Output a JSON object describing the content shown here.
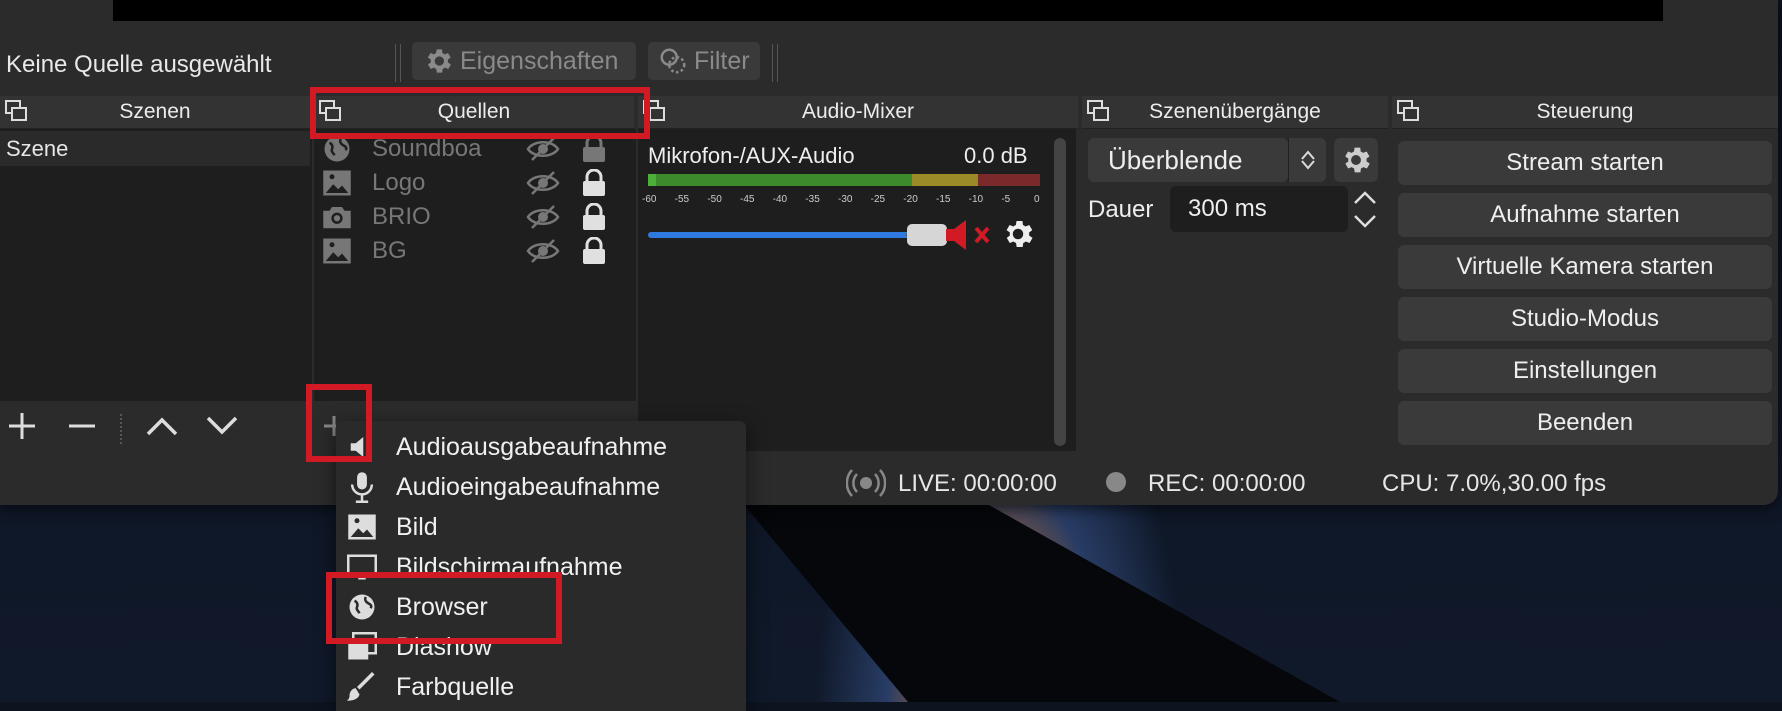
{
  "context_bar": {
    "no_source": "Keine Quelle ausgewählt",
    "properties": "Eigenschaften",
    "filter": "Filter"
  },
  "docks": {
    "scenes": {
      "title": "Szenen",
      "items": [
        "Szene"
      ]
    },
    "sources": {
      "title": "Quellen",
      "items": [
        {
          "name": "Soundboa",
          "icon": "globe-icon"
        },
        {
          "name": "Logo",
          "icon": "image-icon"
        },
        {
          "name": "BRIO",
          "icon": "camera-icon"
        },
        {
          "name": "BG",
          "icon": "image-icon"
        }
      ]
    },
    "mixer": {
      "title": "Audio-Mixer",
      "channel": "Mikrofon-/AUX-Audio",
      "level": "0.0 dB",
      "ticks": [
        "-60",
        "-55",
        "-50",
        "-45",
        "-40",
        "-35",
        "-30",
        "-25",
        "-20",
        "-15",
        "-10",
        "-5",
        "0"
      ],
      "volume_fraction": 0.96
    },
    "transitions": {
      "title": "Szenenübergänge",
      "selected": "Überblende",
      "duration_label": "Dauer",
      "duration_value": "300 ms"
    },
    "controls": {
      "title": "Steuerung",
      "buttons": [
        "Stream starten",
        "Aufnahme starten",
        "Virtuelle Kamera starten",
        "Studio-Modus",
        "Einstellungen",
        "Beenden"
      ]
    }
  },
  "status": {
    "live": "LIVE: 00:00:00",
    "rec": "REC: 00:00:00",
    "cpu": "CPU: 7.0%,30.00 fps"
  },
  "add_menu": {
    "items": [
      {
        "label": "Audioausgabeaufnahme",
        "icon": "speaker-icon"
      },
      {
        "label": "Audioeingabeaufnahme",
        "icon": "microphone-icon"
      },
      {
        "label": "Bild",
        "icon": "image-icon"
      },
      {
        "label": "Bildschirmaufnahme",
        "icon": "monitor-icon"
      },
      {
        "label": "Browser",
        "icon": "globe-icon"
      },
      {
        "label": "Diashow",
        "icon": "slideshow-icon"
      },
      {
        "label": "Farbquelle",
        "icon": "brush-icon"
      }
    ]
  },
  "colors": {
    "highlight": "#d11a24",
    "accent": "#2f7ae0",
    "window_bg": "#2b2b2b"
  }
}
